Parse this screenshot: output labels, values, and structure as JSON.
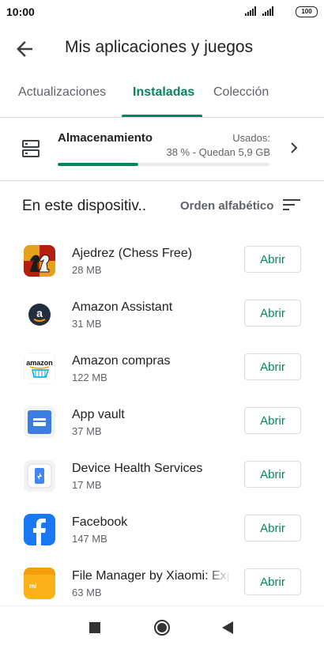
{
  "status_bar": {
    "time": "10:00",
    "battery": "100"
  },
  "app_bar": {
    "title": "Mis aplicaciones y juegos"
  },
  "tabs": [
    {
      "label": "Actualizaciones"
    },
    {
      "label": "Instaladas"
    },
    {
      "label": "Colección"
    }
  ],
  "active_tab": "Instaladas",
  "storage": {
    "title": "Almacenamiento",
    "used_label": "Usados:",
    "detail": "38 % - Quedan 5,9 GB",
    "used_fraction": 0.38
  },
  "section": {
    "title": "En este dispositiv..",
    "sort_label": "Orden alfabético"
  },
  "apps": [
    {
      "name": "Ajedrez (Chess Free)",
      "size": "28 MB",
      "button": "Abrir",
      "icon": "chess-icon"
    },
    {
      "name": "Amazon Assistant",
      "size": "31 MB",
      "button": "Abrir",
      "icon": "amazon-assistant-icon"
    },
    {
      "name": "Amazon compras",
      "size": "122 MB",
      "button": "Abrir",
      "icon": "amazon-shopping-icon"
    },
    {
      "name": "App vault",
      "size": "37 MB",
      "button": "Abrir",
      "icon": "app-vault-icon"
    },
    {
      "name": "Device Health Services",
      "size": "17 MB",
      "button": "Abrir",
      "icon": "device-health-icon"
    },
    {
      "name": "Facebook",
      "size": "147 MB",
      "button": "Abrir",
      "icon": "facebook-icon"
    },
    {
      "name": "File Manager by Xiaomi: Exp",
      "size": "63 MB",
      "button": "Abrir",
      "icon": "file-manager-icon"
    }
  ],
  "colors": {
    "accent": "#01875f",
    "divider": "#dadce0",
    "text_secondary": "#5f6368"
  }
}
